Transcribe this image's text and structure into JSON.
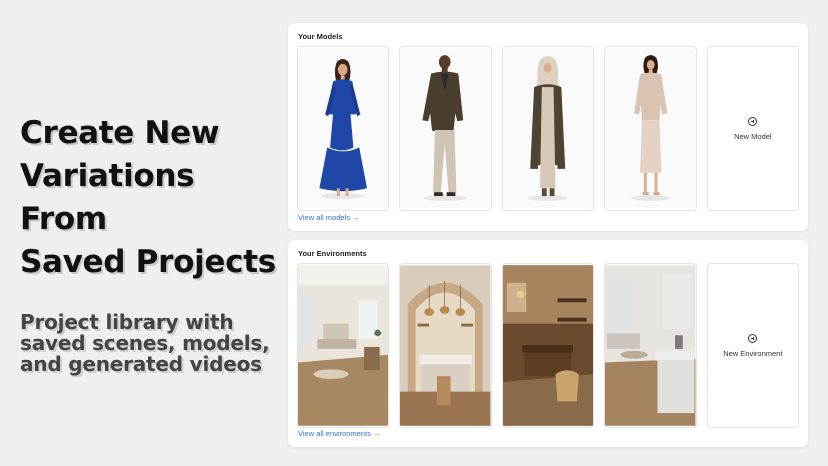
{
  "promo": {
    "title_lines": [
      "Create New",
      "Variations From",
      "Saved Projects"
    ],
    "subtitle_lines": [
      "Project library with",
      "saved scenes, models,",
      "and generated videos"
    ]
  },
  "models": {
    "title": "Your Models",
    "items": [
      {
        "name": "Model in blue dress",
        "color": "#1f47a8"
      },
      {
        "name": "Model in olive blazer",
        "color": "#4a3f2e"
      },
      {
        "name": "Model in hijab with cardigan",
        "color": "#4d4532"
      },
      {
        "name": "Model in beige knit set",
        "color": "#d9c3b3"
      }
    ],
    "new_label": "New Model",
    "view_all": "View all models →"
  },
  "environments": {
    "title": "Your Environments",
    "items": [
      {
        "name": "Bright living room"
      },
      {
        "name": "Arched kitchen"
      },
      {
        "name": "Rustic kitchen"
      },
      {
        "name": "Modern living room"
      }
    ],
    "new_label": "New Environment",
    "view_all": "View all environments →"
  },
  "icons": {
    "add": "plus-circle-icon"
  }
}
